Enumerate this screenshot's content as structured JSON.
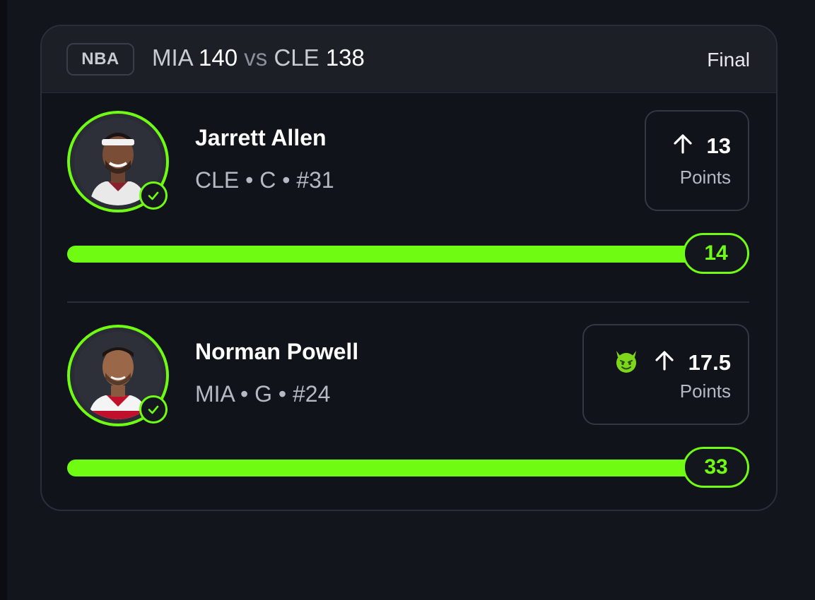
{
  "header": {
    "league": "NBA",
    "away_team": "MIA",
    "away_score": "140",
    "vs": "vs",
    "home_team": "CLE",
    "home_score": "138",
    "status": "Final"
  },
  "players": [
    {
      "name": "Jarrett Allen",
      "meta": "CLE • C • #31",
      "direction_icon": "arrow-up-icon",
      "line": "13",
      "stat": "Points",
      "result": "14",
      "progress_fraction": 1.0,
      "has_devil_emoji": false
    },
    {
      "name": "Norman Powell",
      "meta": "MIA • G • #24",
      "direction_icon": "arrow-up-icon",
      "line": "17.5",
      "stat": "Points",
      "result": "33",
      "progress_fraction": 1.0,
      "has_devil_emoji": true
    }
  ],
  "colors": {
    "accent": "#6ffc12",
    "background": "#13151d",
    "card": "#11131b",
    "header": "#1d1f27"
  }
}
